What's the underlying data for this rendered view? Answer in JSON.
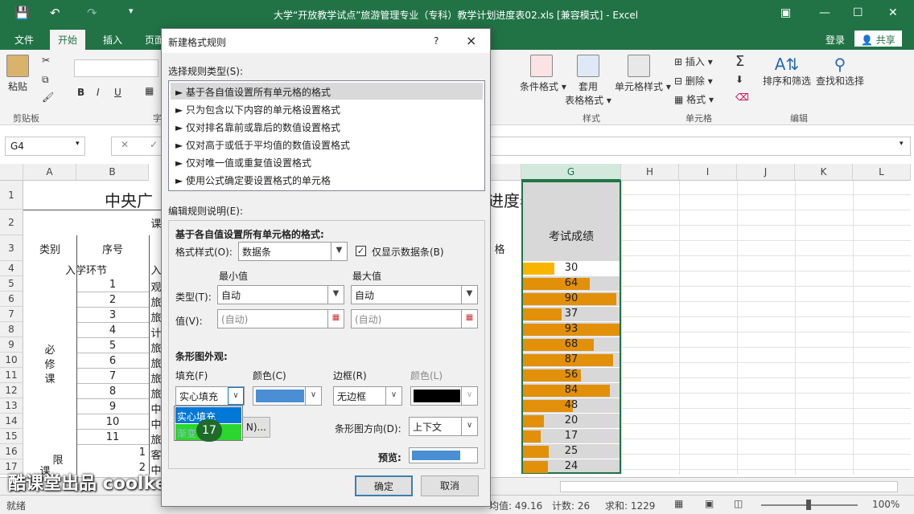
{
  "window": {
    "title": "大学“开放教学试点”旅游管理专业（专科）教学计划进度表02.xls  [兼容模式] - Excel"
  },
  "ribbon": {
    "tabs": [
      "文件",
      "开始",
      "插入",
      "页面"
    ],
    "active_tab": "开始",
    "login": "登录",
    "share": "共享",
    "paste": "粘贴",
    "clipboard_group": "剪贴板",
    "styles_group": "样式",
    "cells_group": "单元格",
    "edit_group": "编辑",
    "cond_format": "条件格式",
    "table_format": "套用\n表格格式",
    "cell_style": "单元格样式",
    "insert": "插入",
    "delete": "删除",
    "format": "格式",
    "sort_filter": "排序和筛选",
    "find_select": "查找和选择"
  },
  "formula": {
    "namebox": "G4"
  },
  "sheet": {
    "cols": [
      "A",
      "B",
      "G",
      "H",
      "I",
      "J",
      "K",
      "L"
    ],
    "rows": [
      "1",
      "2",
      "3",
      "4",
      "5",
      "6",
      "7",
      "8",
      "9",
      "10",
      "11",
      "12",
      "13",
      "14",
      "15",
      "16",
      "17"
    ],
    "title_frag": "中央广",
    "title_tail": "进度表",
    "row2_frag": "课",
    "hdr_cat": "类别",
    "hdr_seq": "序号",
    "hdr_score": "考试成绩",
    "hdr_frag": "格",
    "enroll": "入学环节",
    "enroll_frag": "入",
    "required": "必\n修\n课",
    "limited": "限",
    "course": "课",
    "seq": [
      "1",
      "2",
      "3",
      "4",
      "5",
      "6",
      "7",
      "8",
      "9",
      "10",
      "11"
    ],
    "seq16": "1",
    "seq17": "2",
    "b_frags": [
      "观",
      "旅",
      "旅",
      "计",
      "旅",
      "旅",
      "旅",
      "旅",
      "中",
      "中",
      "旅",
      "客",
      "中"
    ],
    "scores": [
      30,
      64,
      90,
      37,
      93,
      68,
      87,
      56,
      84,
      48,
      20,
      17,
      25,
      24
    ]
  },
  "dialog": {
    "title": "新建格式规则",
    "help": "?",
    "close": "×",
    "rule_type_label": "选择规则类型(S):",
    "rules": [
      "► 基于各自值设置所有单元格的格式",
      "► 只为包含以下内容的单元格设置格式",
      "► 仅对排名靠前或靠后的数值设置格式",
      "► 仅对高于或低于平均值的数值设置格式",
      "► 仅对唯一值或重复值设置格式",
      "► 使用公式确定要设置格式的单元格"
    ],
    "edit_label": "编辑规则说明(E):",
    "desc_heading": "基于各自值设置所有单元格的格式:",
    "format_style_label": "格式样式(O):",
    "format_style": "数据条",
    "show_bar_only": "仅显示数据条(B)",
    "min": "最小值",
    "max": "最大值",
    "type_label": "类型(T):",
    "type_min": "自动",
    "type_max": "自动",
    "value_label": "值(V):",
    "value_min": "(自动)",
    "value_max": "(自动)",
    "bar_appearance": "条形图外观:",
    "fill_label": "填充(F)",
    "color_label": "颜色(C)",
    "border_label": "边框(R)",
    "border_color_label": "颜色(L)",
    "fill_value": "实心填充",
    "border_value": "无边框",
    "fill_options": [
      "实心填充",
      "渐变"
    ],
    "neg_btn_frag": "N)...",
    "direction_label": "条形图方向(D):",
    "direction": "上下文",
    "preview_label": "预览:",
    "ok": "确定",
    "cancel": "取消",
    "badge": "17"
  },
  "status": {
    "ready": "就绪",
    "avg": "均值: 49.16",
    "count": "计数: 26",
    "sum": "求和: 1229",
    "zoom": "100%"
  },
  "watermark": "酷课堂出品 coolketang.com",
  "colors": {
    "excel_green": "#217346",
    "bar_orange": "#e2900a",
    "bar_blue": "#4a8fd4"
  }
}
